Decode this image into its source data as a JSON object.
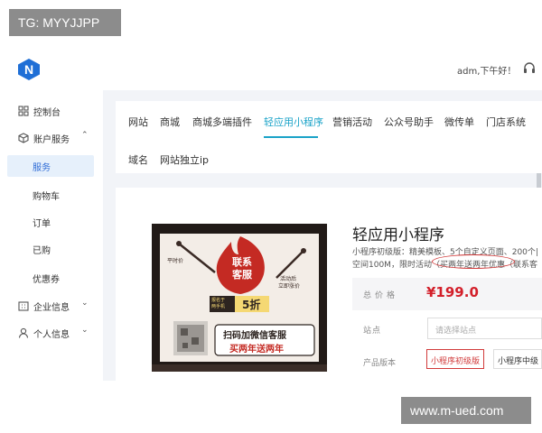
{
  "watermarks": {
    "top": "TG: MYYJJPP",
    "bottom": "www.m-ued.com"
  },
  "header": {
    "greeting": "adm,下午好！",
    "logo_letter": "N",
    "brand_color": "#1f6fd6"
  },
  "sidebar": {
    "items": [
      {
        "label": "控制台",
        "icon": "grid-icon"
      },
      {
        "label": "账户服务",
        "icon": "cube-icon",
        "expanded": true,
        "chevron": "⌃"
      },
      {
        "label": "企业信息",
        "icon": "building-icon",
        "chevron": "⌄"
      },
      {
        "label": "个人信息",
        "icon": "user-icon",
        "chevron": "⌄"
      }
    ],
    "sub_items": [
      {
        "label": "服务",
        "active": true
      },
      {
        "label": "购物车"
      },
      {
        "label": "订单"
      },
      {
        "label": "已购"
      },
      {
        "label": "优惠券"
      }
    ]
  },
  "tabs": {
    "row1": [
      "网站",
      "商城",
      "商城多端插件",
      "轻应用小程序",
      "营销活动",
      "公众号助手",
      "微传单",
      "门店系统"
    ],
    "row2": [
      "域名",
      "网站独立ip"
    ],
    "active": "轻应用小程序",
    "accent_color": "#1aa3c8"
  },
  "product": {
    "title": "轻应用小程序",
    "desc_line1": "小程序初级版：精美模板、5个自定义页面、200个|",
    "desc_line2": "空间100M，限时活动（买两年送两年优惠（联系客",
    "highlight": "买两年送两年优惠",
    "price_label": "总价格",
    "price": "¥199.0",
    "site_label": "站点",
    "site_placeholder": "请选择站点",
    "version_label": "产品版本",
    "versions": [
      "小程序初级版",
      "小程序中级"
    ],
    "selected_version": "小程序初级版",
    "price_color": "#d31f2a"
  },
  "poster": {
    "badge_line1": "联系",
    "badge_line2": "客服",
    "left_note": "平时价",
    "right_note_1": "活动后",
    "right_note_2": "立即涨价",
    "discount_small_1": "报名于",
    "discount_small_2": "两手机",
    "discount": "5折",
    "qr_caption_1": "扫码加微信客服",
    "qr_caption_2": "买两年送两年"
  }
}
